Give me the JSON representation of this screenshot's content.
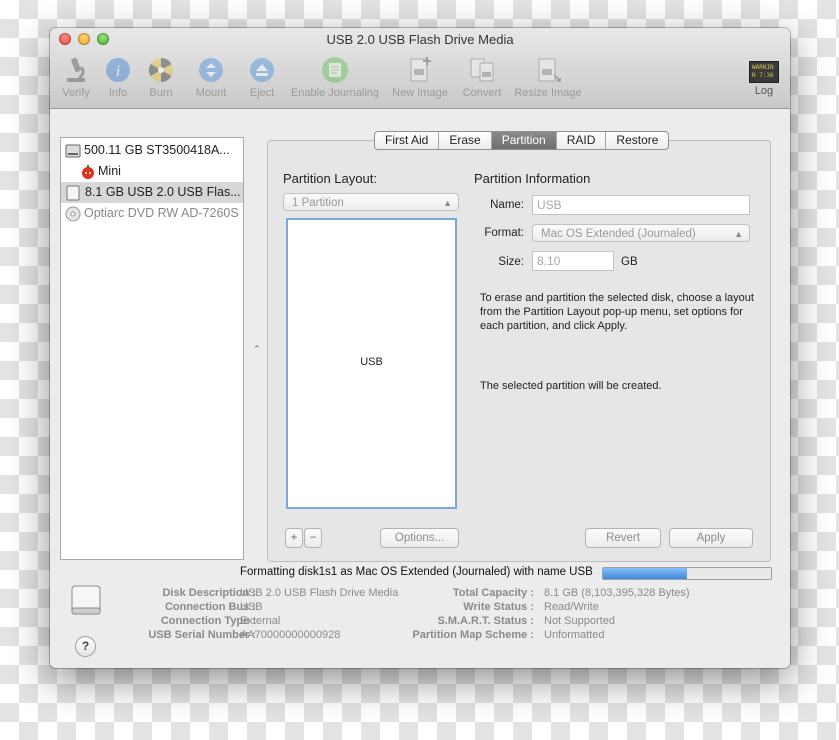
{
  "window": {
    "title": "USB 2.0 USB Flash Drive Media"
  },
  "toolbar": {
    "items": [
      {
        "label": "Verify",
        "icon": "microscope-icon"
      },
      {
        "label": "Info",
        "icon": "info-icon"
      },
      {
        "label": "Burn",
        "icon": "burn-icon"
      },
      {
        "label": "Mount",
        "icon": "mount-icon"
      },
      {
        "label": "Eject",
        "icon": "eject-icon"
      },
      {
        "label": "Enable Journaling",
        "icon": "journaling-icon"
      },
      {
        "label": "New Image",
        "icon": "new-image-icon"
      },
      {
        "label": "Convert",
        "icon": "convert-icon"
      },
      {
        "label": "Resize Image",
        "icon": "resize-image-icon"
      },
      {
        "label": "Log",
        "icon": "log-icon",
        "icon_text": "WARNIN\nN 7:36"
      }
    ]
  },
  "sidebar": {
    "items": [
      {
        "label": "500.11 GB ST3500418A...",
        "icon": "hard-disk-icon"
      },
      {
        "label": "Mini",
        "icon": "volume-apple-icon"
      },
      {
        "label": "8.1 GB USB 2.0 USB Flas...",
        "icon": "usb-drive-icon"
      },
      {
        "label": "Optiarc DVD RW AD-7260S",
        "icon": "optical-drive-icon"
      }
    ]
  },
  "tabs": [
    "First Aid",
    "Erase",
    "Partition",
    "RAID",
    "Restore"
  ],
  "partition": {
    "layout_label": "Partition Layout:",
    "layout_value": "1 Partition",
    "info_title": "Partition Information",
    "name_label": "Name:",
    "name_value": "USB",
    "format_label": "Format:",
    "format_value": "Mac OS Extended (Journaled)",
    "size_label": "Size:",
    "size_value": "8.10",
    "size_unit": "GB",
    "partition_name": "USB",
    "help_text": "To erase and partition the selected disk, choose a layout from the Partition Layout pop-up menu, set options for each partition, and click Apply.",
    "selected_text": "The selected partition will be created.",
    "add_label": "+",
    "remove_label": "−",
    "options_label": "Options...",
    "revert_label": "Revert",
    "apply_label": "Apply"
  },
  "status": {
    "text": "Formatting disk1s1 as Mac OS Extended (Journaled) with name USB",
    "progress": 0.5
  },
  "disk_info": {
    "left": [
      {
        "label": "Disk Description :",
        "value": "USB 2.0 USB Flash Drive Media"
      },
      {
        "label": "Connection Bus :",
        "value": "USB"
      },
      {
        "label": "Connection Type :",
        "value": "External"
      },
      {
        "label": "USB Serial Number :",
        "value": "AA70000000000928"
      }
    ],
    "right": [
      {
        "label": "Total Capacity :",
        "value": "8.1 GB (8,103,395,328 Bytes)"
      },
      {
        "label": "Write Status :",
        "value": "Read/Write"
      },
      {
        "label": "S.M.A.R.T. Status :",
        "value": "Not Supported"
      },
      {
        "label": "Partition Map Scheme :",
        "value": "Unformatted"
      }
    ]
  },
  "help_button": "?"
}
